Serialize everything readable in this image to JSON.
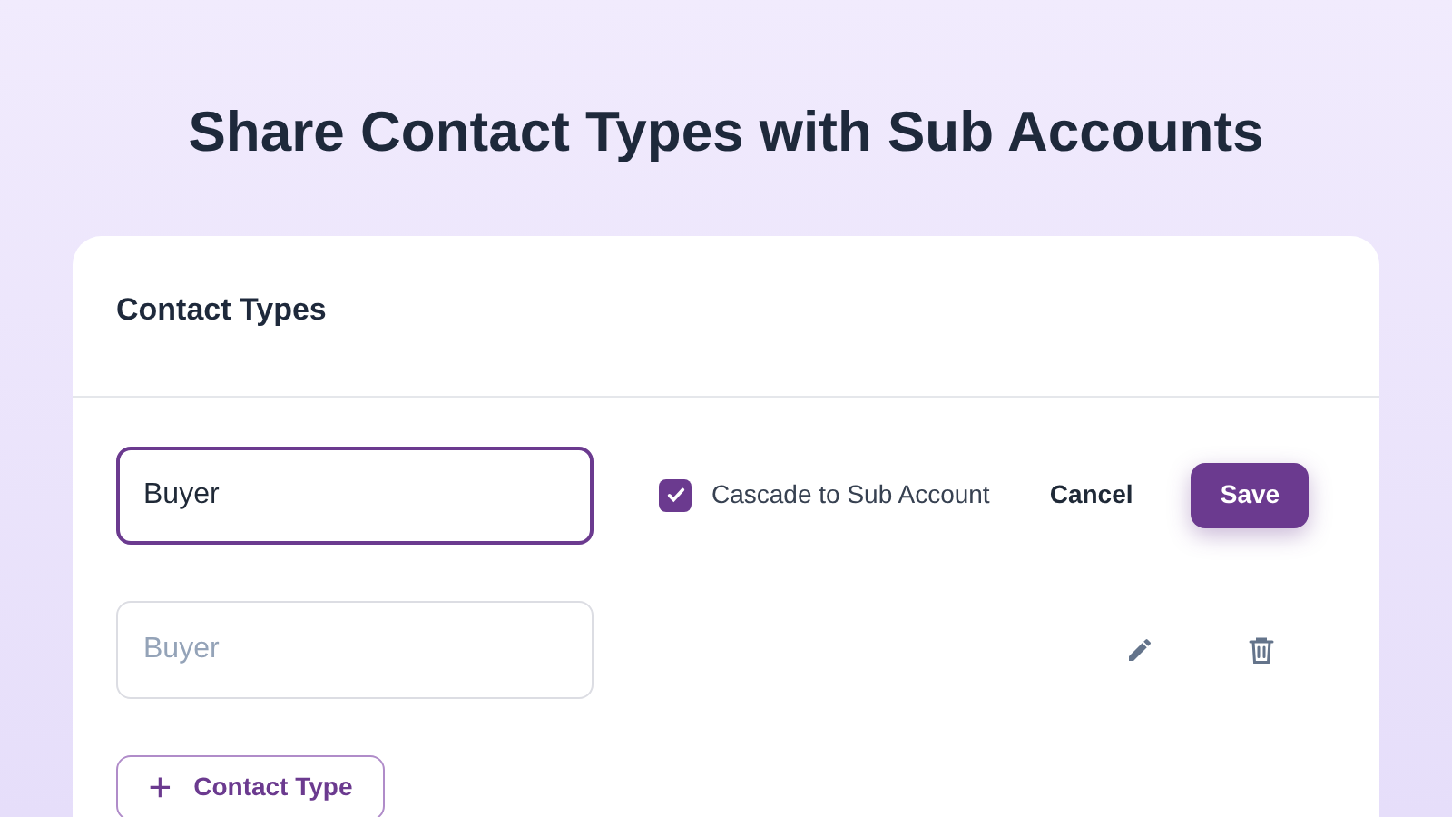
{
  "page_title": "Share Contact Types with Sub Accounts",
  "card": {
    "title": "Contact Types",
    "rows": [
      {
        "kind": "editing",
        "value": "Buyer",
        "cascade": {
          "label": "Cascade to Sub Account",
          "checked": true
        },
        "cancel": "Cancel",
        "save": "Save"
      },
      {
        "kind": "saved",
        "value": "Buyer"
      }
    ],
    "add_button": {
      "icon": "+",
      "label": "Contact Type"
    }
  }
}
